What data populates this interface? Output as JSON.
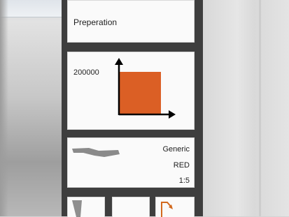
{
  "viewport": {
    "material_label": "Preperation"
  },
  "chart_preview": {
    "value_label": "200000",
    "swatch_color": "#db5f25"
  },
  "type_panel": {
    "type_label": "Generic",
    "color_label": "RED",
    "scale_label": "1:5"
  },
  "thumbnails": [
    {
      "icon": "wedge-icon"
    },
    {
      "icon": "blank"
    },
    {
      "icon": "flag-arrow-icon"
    }
  ]
}
